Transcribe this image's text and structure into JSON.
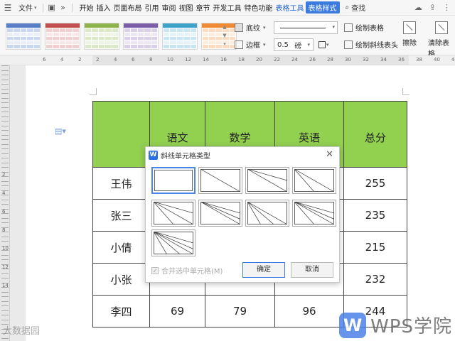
{
  "menu": {
    "file": "文件",
    "tabs": [
      "开始",
      "插入",
      "页面布局",
      "引用",
      "审阅",
      "视图",
      "章节",
      "开发工具",
      "特色功能"
    ],
    "context_tab": "表格工具",
    "active_tab": "表格样式",
    "search": "查找"
  },
  "ribbon": {
    "shading": "底纹",
    "border": "边框",
    "line_width": "0.5",
    "line_unit": "磅",
    "draw_table": "绘制表格",
    "draw_diagonal": "绘制斜线表头",
    "erase": "擦除",
    "clear_style": "清除表格"
  },
  "ruler": {
    "numbers": [
      "6",
      "4",
      "2",
      "2",
      "4",
      "6",
      "8",
      "10",
      "12",
      "14",
      "16",
      "18",
      "20",
      "22",
      "24",
      "26",
      "28",
      "30",
      "32",
      "34",
      "36",
      "38",
      "40",
      "42"
    ],
    "vertical_numbers": [
      "2",
      "4",
      "6",
      "8",
      "10",
      "12",
      "14"
    ]
  },
  "table": {
    "header": [
      "",
      "语文",
      "数学",
      "英语",
      "总分"
    ],
    "rows": [
      [
        "王伟",
        "",
        "",
        "",
        "255"
      ],
      [
        "张三",
        "",
        "",
        "",
        "235"
      ],
      [
        "小倩",
        "",
        "",
        "",
        "215"
      ],
      [
        "小张",
        "",
        "",
        "",
        "232"
      ],
      [
        "李四",
        "69",
        "79",
        "96",
        "244"
      ]
    ]
  },
  "dialog": {
    "title": "斜线单元格类型",
    "checkbox": "合并选中单元格(M)",
    "ok": "确定",
    "cancel": "取消"
  },
  "brand": {
    "logo_text": "WPS学院",
    "watermark": "大数据园"
  },
  "colors": {
    "header_fill": "#92d050",
    "accent": "#3b7be0"
  }
}
